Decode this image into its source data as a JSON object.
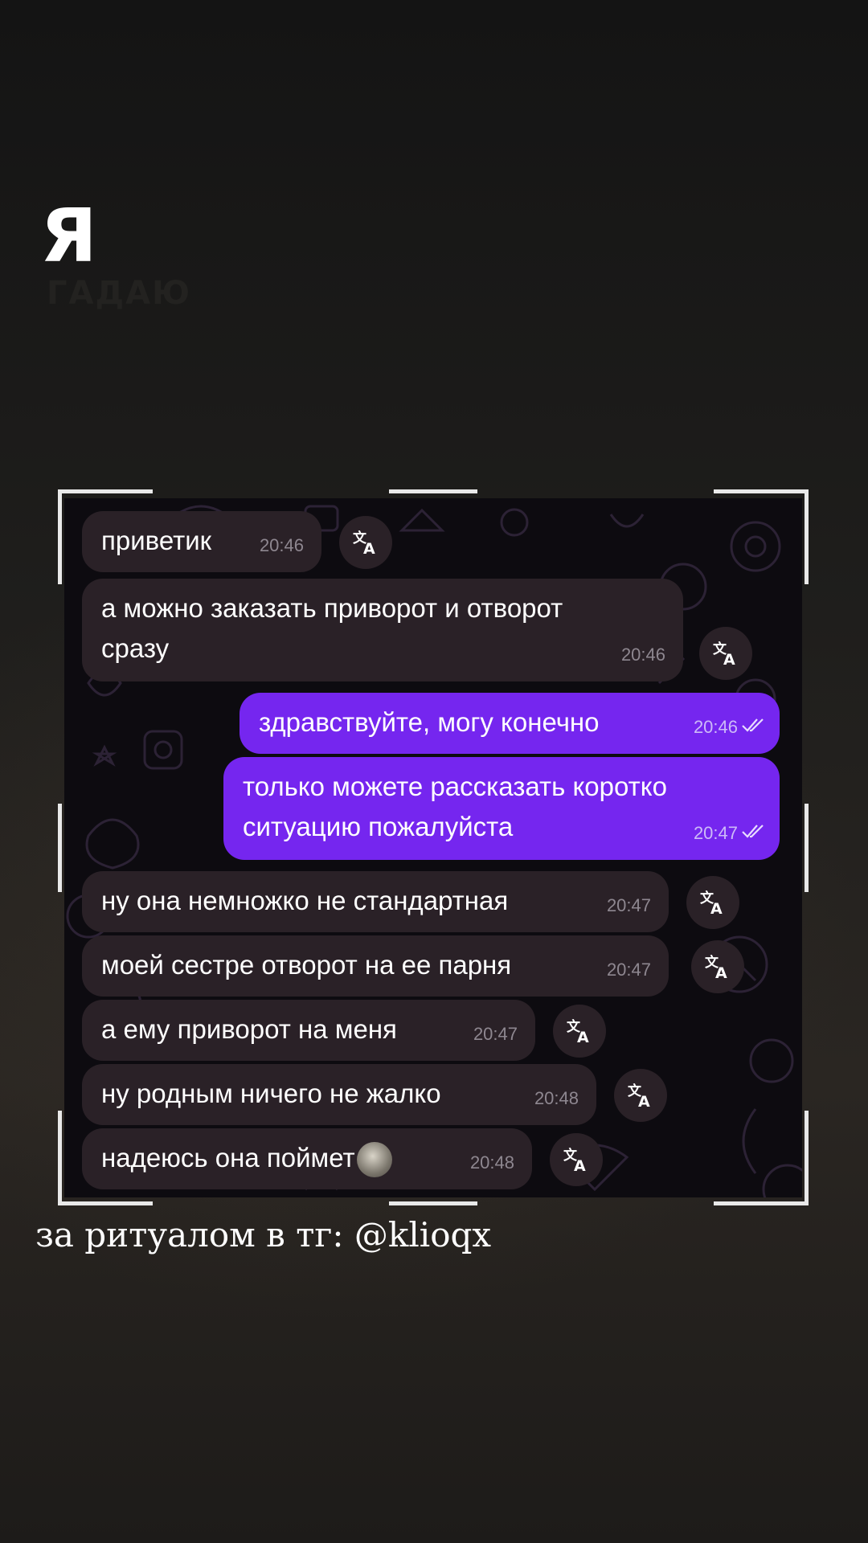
{
  "header": {
    "title_letter": "Я",
    "title_ghost": "ГАДАЮ"
  },
  "chat": {
    "messages": [
      {
        "side": "in",
        "lines": [
          "приветик"
        ],
        "time": "20:46",
        "translate": true
      },
      {
        "side": "in",
        "lines": [
          "а можно заказать приворот и отворот",
          "сразу"
        ],
        "time": "20:46",
        "translate": true
      },
      {
        "side": "out",
        "lines": [
          "здравствуйте, могу конечно"
        ],
        "time": "20:46",
        "read": true
      },
      {
        "side": "out",
        "lines": [
          "только можете рассказать коротко",
          "ситуацию пожалуйста"
        ],
        "time": "20:47",
        "read": true
      },
      {
        "side": "in",
        "lines": [
          "ну она немножко не стандартная"
        ],
        "time": "20:47",
        "translate": true
      },
      {
        "side": "in",
        "lines": [
          "моей сестре отворот на ее парня"
        ],
        "time": "20:47",
        "translate": true
      },
      {
        "side": "in",
        "lines": [
          "а ему приворот на меня"
        ],
        "time": "20:47",
        "translate": true
      },
      {
        "side": "in",
        "lines": [
          "ну родным ничего не жалко"
        ],
        "time": "20:48",
        "translate": true
      },
      {
        "side": "in",
        "lines": [
          "надеюсь она поймет"
        ],
        "time": "20:48",
        "translate": true,
        "sticker": true
      }
    ],
    "icons": {
      "translate": "translate-icon",
      "read": "double-check-icon",
      "sticker": "sticker-emoji-icon"
    }
  },
  "caption": "за ритуалом в тг: @klioqx",
  "colors": {
    "incoming_bubble": "#2a2127",
    "outgoing_bubble": "#7526ef",
    "chat_background": "#0d0b10"
  }
}
